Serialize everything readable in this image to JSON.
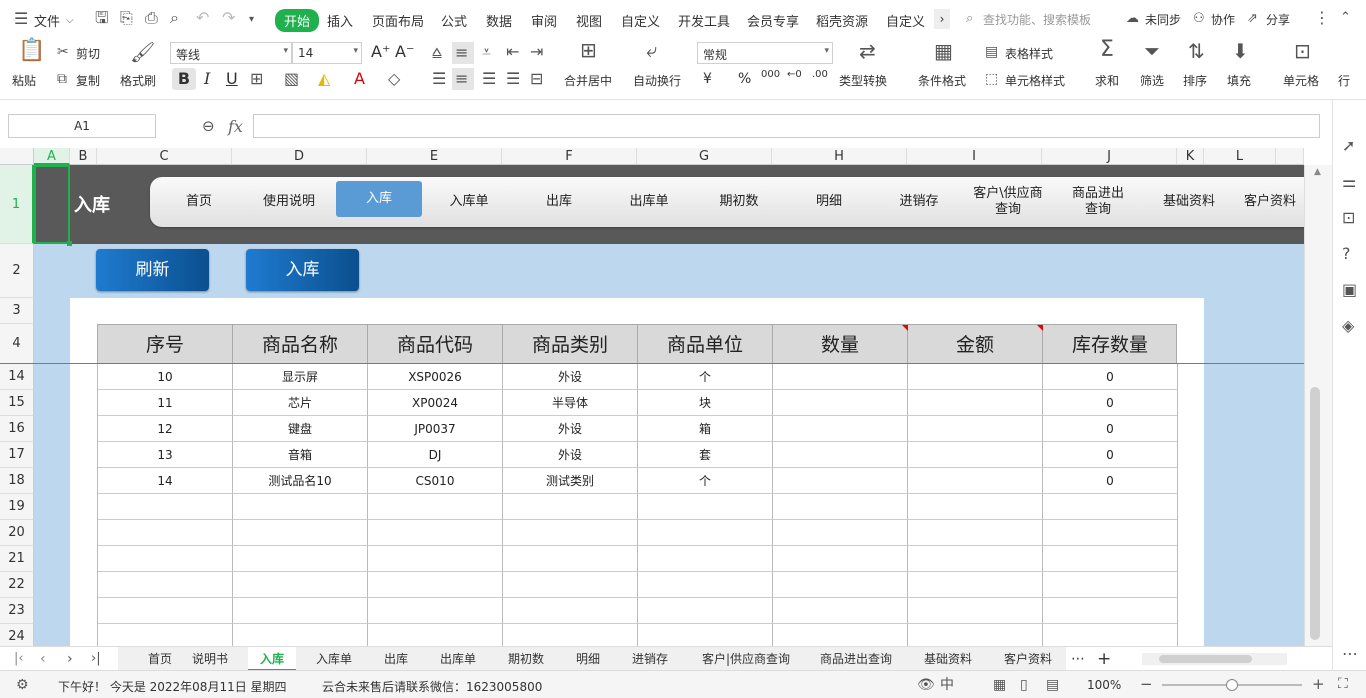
{
  "menu": {
    "file": "文件",
    "items": [
      "开始",
      "插入",
      "页面布局",
      "公式",
      "数据",
      "审阅",
      "视图",
      "自定义",
      "开发工具",
      "会员专享",
      "稻壳资源",
      "自定义"
    ],
    "search_placeholder": "查找功能、搜索模板",
    "sync": "未同步",
    "collab": "协作",
    "share": "分享"
  },
  "ribbon": {
    "paste": "粘贴",
    "cut": "剪切",
    "copy": "复制",
    "format_painter": "格式刷",
    "font": "等线",
    "size": "14",
    "merge": "合并居中",
    "wrap": "自动换行",
    "number_format": "常规",
    "convert": "类型转换",
    "cond_format": "条件格式",
    "table_style": "表格样式",
    "cell_style": "单元格样式",
    "sum": "求和",
    "filter": "筛选",
    "sort": "排序",
    "fill": "填充",
    "cell": "单元格",
    "row": "行"
  },
  "formula": {
    "namebox": "A1",
    "fx": "fx",
    "value": ""
  },
  "columns": [
    "A",
    "B",
    "C",
    "D",
    "E",
    "F",
    "G",
    "H",
    "I",
    "J",
    "K",
    "L"
  ],
  "rows": [
    "1",
    "2",
    "3",
    "4",
    "14",
    "15",
    "16",
    "17",
    "18",
    "19",
    "20",
    "21",
    "22",
    "23",
    "24"
  ],
  "sheet": {
    "title": "入库",
    "nav": [
      "首页",
      "使用说明",
      "入库",
      "入库单",
      "出库",
      "出库单",
      "期初数",
      "明细",
      "进销存",
      "客户\\供应商查询",
      "商品进出查询",
      "基础资料",
      "客户资料"
    ],
    "refresh_btn": "刷新",
    "inbound_btn": "入库",
    "headers": [
      "序号",
      "商品名称",
      "商品代码",
      "商品类别",
      "商品单位",
      "数量",
      "金额",
      "库存数量"
    ],
    "data": [
      [
        "10",
        "显示屏",
        "XSP0026",
        "外设",
        "个",
        "",
        "",
        "0"
      ],
      [
        "11",
        "芯片",
        "XP0024",
        "半导体",
        "块",
        "",
        "",
        "0"
      ],
      [
        "12",
        "键盘",
        "JP0037",
        "外设",
        "箱",
        "",
        "",
        "0"
      ],
      [
        "13",
        "音箱",
        "DJ",
        "外设",
        "套",
        "",
        "",
        "0"
      ],
      [
        "14",
        "测试品名10",
        "CS010",
        "测试类别",
        "个",
        "",
        "",
        "0"
      ]
    ]
  },
  "tabs": [
    "首页",
    "说明书",
    "入库",
    "入库单",
    "出库",
    "出库单",
    "期初数",
    "明细",
    "进销存",
    "客户|供应商查询",
    "商品进出查询",
    "基础资料",
    "客户资料"
  ],
  "status": {
    "greeting": "下午好！ 今天是 2022年08月11日 星期四",
    "message": "云合未来售后请联系微信：1623005800",
    "zoom": "100%"
  },
  "colors": {
    "accent": "#1fb14d",
    "nav_bg": "#595959",
    "sheet_bg": "#bdd7ee",
    "btn_blue": "#1a6bb8",
    "active_nav": "#5b9bd5"
  }
}
